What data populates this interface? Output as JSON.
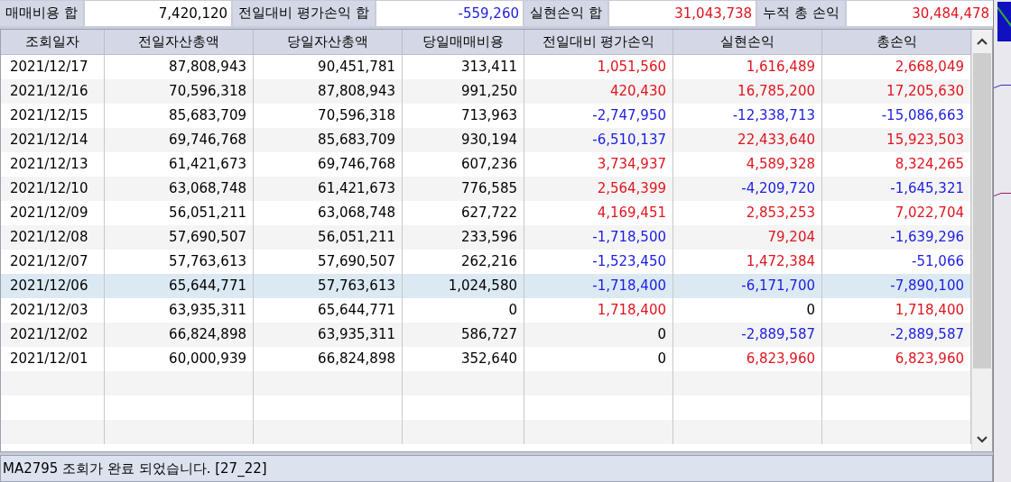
{
  "summary": [
    {
      "label": "매매비용 합",
      "value": "7,420,120",
      "color": "#000000"
    },
    {
      "label": "전일대비 평가손익 합",
      "value": "-559,260",
      "color": "#1c1ce0"
    },
    {
      "label": "실현손익 합",
      "value": "31,043,738",
      "color": "#e0141e"
    },
    {
      "label": "누적 총 손익",
      "value": "30,484,478",
      "color": "#e0141e"
    }
  ],
  "table": {
    "columns": [
      "조회일자",
      "전일자산총액",
      "당일자산총액",
      "당일매매비용",
      "전일대비 평가손익",
      "실현손익",
      "총손익"
    ],
    "rows": [
      {
        "selected": false,
        "cells": [
          "2021/12/17",
          "87,808,943",
          "90,451,781",
          "313,411"
        ],
        "pl": [
          {
            "text": "1,051,560",
            "color": "#e0141e"
          },
          {
            "text": "1,616,489",
            "color": "#e0141e"
          },
          {
            "text": "2,668,049",
            "color": "#e0141e"
          }
        ]
      },
      {
        "selected": false,
        "cells": [
          "2021/12/16",
          "70,596,318",
          "87,808,943",
          "991,250"
        ],
        "pl": [
          {
            "text": "420,430",
            "color": "#e0141e"
          },
          {
            "text": "16,785,200",
            "color": "#e0141e"
          },
          {
            "text": "17,205,630",
            "color": "#e0141e"
          }
        ]
      },
      {
        "selected": false,
        "cells": [
          "2021/12/15",
          "85,683,709",
          "70,596,318",
          "713,963"
        ],
        "pl": [
          {
            "text": "-2,747,950",
            "color": "#1c1ce0"
          },
          {
            "text": "-12,338,713",
            "color": "#1c1ce0"
          },
          {
            "text": "-15,086,663",
            "color": "#1c1ce0"
          }
        ]
      },
      {
        "selected": false,
        "cells": [
          "2021/12/14",
          "69,746,768",
          "85,683,709",
          "930,194"
        ],
        "pl": [
          {
            "text": "-6,510,137",
            "color": "#1c1ce0"
          },
          {
            "text": "22,433,640",
            "color": "#e0141e"
          },
          {
            "text": "15,923,503",
            "color": "#e0141e"
          }
        ]
      },
      {
        "selected": false,
        "cells": [
          "2021/12/13",
          "61,421,673",
          "69,746,768",
          "607,236"
        ],
        "pl": [
          {
            "text": "3,734,937",
            "color": "#e0141e"
          },
          {
            "text": "4,589,328",
            "color": "#e0141e"
          },
          {
            "text": "8,324,265",
            "color": "#e0141e"
          }
        ]
      },
      {
        "selected": false,
        "cells": [
          "2021/12/10",
          "63,068,748",
          "61,421,673",
          "776,585"
        ],
        "pl": [
          {
            "text": "2,564,399",
            "color": "#e0141e"
          },
          {
            "text": "-4,209,720",
            "color": "#1c1ce0"
          },
          {
            "text": "-1,645,321",
            "color": "#1c1ce0"
          }
        ]
      },
      {
        "selected": false,
        "cells": [
          "2021/12/09",
          "56,051,211",
          "63,068,748",
          "627,722"
        ],
        "pl": [
          {
            "text": "4,169,451",
            "color": "#e0141e"
          },
          {
            "text": "2,853,253",
            "color": "#e0141e"
          },
          {
            "text": "7,022,704",
            "color": "#e0141e"
          }
        ]
      },
      {
        "selected": false,
        "cells": [
          "2021/12/08",
          "57,690,507",
          "56,051,211",
          "233,596"
        ],
        "pl": [
          {
            "text": "-1,718,500",
            "color": "#1c1ce0"
          },
          {
            "text": "79,204",
            "color": "#e0141e"
          },
          {
            "text": "-1,639,296",
            "color": "#1c1ce0"
          }
        ]
      },
      {
        "selected": false,
        "cells": [
          "2021/12/07",
          "57,763,613",
          "57,690,507",
          "262,216"
        ],
        "pl": [
          {
            "text": "-1,523,450",
            "color": "#1c1ce0"
          },
          {
            "text": "1,472,384",
            "color": "#e0141e"
          },
          {
            "text": "-51,066",
            "color": "#1c1ce0"
          }
        ]
      },
      {
        "selected": true,
        "cells": [
          "2021/12/06",
          "65,644,771",
          "57,763,613",
          "1,024,580"
        ],
        "pl": [
          {
            "text": "-1,718,400",
            "color": "#1c1ce0"
          },
          {
            "text": "-6,171,700",
            "color": "#1c1ce0"
          },
          {
            "text": "-7,890,100",
            "color": "#1c1ce0"
          }
        ]
      },
      {
        "selected": false,
        "cells": [
          "2021/12/03",
          "63,935,311",
          "65,644,771",
          "0"
        ],
        "pl": [
          {
            "text": "1,718,400",
            "color": "#e0141e"
          },
          {
            "text": "0",
            "color": "#000000"
          },
          {
            "text": "1,718,400",
            "color": "#e0141e"
          }
        ]
      },
      {
        "selected": false,
        "cells": [
          "2021/12/02",
          "66,824,898",
          "63,935,311",
          "586,727"
        ],
        "pl": [
          {
            "text": "0",
            "color": "#000000"
          },
          {
            "text": "-2,889,587",
            "color": "#1c1ce0"
          },
          {
            "text": "-2,889,587",
            "color": "#1c1ce0"
          }
        ]
      },
      {
        "selected": false,
        "cells": [
          "2021/12/01",
          "60,000,939",
          "66,824,898",
          "352,640"
        ],
        "pl": [
          {
            "text": "0",
            "color": "#000000"
          },
          {
            "text": "6,823,960",
            "color": "#e0141e"
          },
          {
            "text": "6,823,960",
            "color": "#e0141e"
          }
        ]
      }
    ]
  },
  "status_bar": "MA2795 조회가 완료 되었습니다. [27_22]"
}
